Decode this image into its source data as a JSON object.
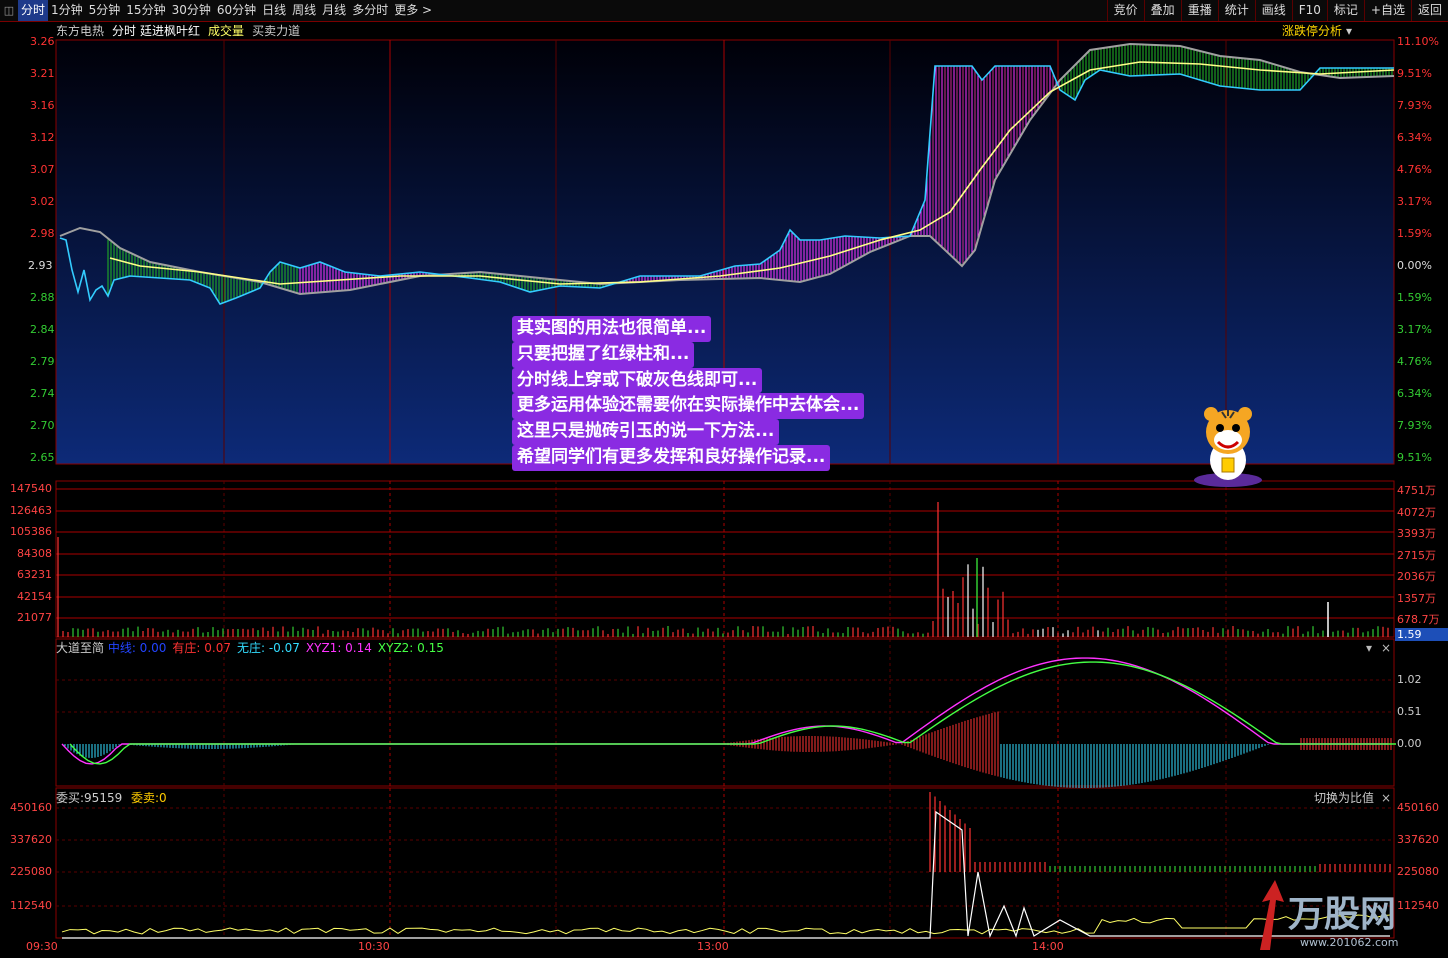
{
  "topbar": {
    "tabs": [
      "分时",
      "1分钟",
      "5分钟",
      "15分钟",
      "30分钟",
      "60分钟",
      "日线",
      "周线",
      "月线",
      "多分时",
      "更多 >"
    ],
    "active_tab": "分时",
    "right_buttons": [
      "竞价",
      "叠加",
      "重播",
      "统计",
      "画线",
      "F10",
      "标记",
      "+自选",
      "返回"
    ]
  },
  "info": {
    "stock": "东方电热",
    "period": "分时",
    "indicator": "廷进枫叶红",
    "volume_label": "成交量",
    "force_label": "买卖力道",
    "right_label": "涨跌停分析"
  },
  "price_axis": {
    "left": [
      "3.26",
      "3.21",
      "3.16",
      "3.12",
      "3.07",
      "3.02",
      "2.98",
      "2.93",
      "2.88",
      "2.84",
      "2.79",
      "2.74",
      "2.70",
      "2.65"
    ],
    "right": [
      "11.10%",
      "9.51%",
      "7.93%",
      "6.34%",
      "4.76%",
      "3.17%",
      "1.59%",
      "0.00%",
      "1.59%",
      "3.17%",
      "4.76%",
      "6.34%",
      "7.93%",
      "9.51%"
    ]
  },
  "volume_axis": {
    "left": [
      "147540",
      "126463",
      "105386",
      "84308",
      "63231",
      "42154",
      "21077"
    ],
    "right": [
      "4751万",
      "4072万",
      "3393万",
      "2715万",
      "2036万",
      "1357万",
      "678.7万"
    ],
    "badge": "1.59"
  },
  "annotation": [
    "其实图的用法也很简单...",
    "只要把握了红绿柱和...",
    "分时线上穿或下破灰色线即可...",
    "更多运用体验还需要你在实际操作中去体会...",
    "这里只是抛砖引玉的说一下方法...",
    "希望同学们有更多发挥和良好操作记录..."
  ],
  "indicator2": {
    "name": "大道至简",
    "items": [
      {
        "label": "中线",
        "value": "0.00",
        "color": "#2244ff"
      },
      {
        "label": "有庄",
        "value": "0.07",
        "color": "#ff3333"
      },
      {
        "label": "无庄",
        "value": "-0.07",
        "color": "#33ddff"
      },
      {
        "label": "XYZ1",
        "value": "0.14",
        "color": "#ff33ff"
      },
      {
        "label": "XYZ2",
        "value": "0.15",
        "color": "#44ff44"
      }
    ],
    "axis": [
      "1.02",
      "0.51",
      "0.00"
    ]
  },
  "indicator3": {
    "buy_label": "委买:95159",
    "sell_label": "委卖:0",
    "switch_label": "切换为比值",
    "axis_left": [
      "450160",
      "337620",
      "225080",
      "112540"
    ],
    "axis_right": [
      "450160",
      "337620",
      "225080",
      "112540"
    ]
  },
  "time_axis": [
    "09:30",
    "10:30",
    "13:00",
    "14:00"
  ],
  "colors": {
    "up": "#ff3333",
    "down": "#33cc33",
    "price_line": "#33ccff",
    "avg_line": "#ffff88",
    "accent": "#8a2be2",
    "magenta": "#ff33ff",
    "teal": "#33ddff"
  },
  "watermark": {
    "brand": "万股网",
    "url": "www.201062.com"
  },
  "icons": [
    "chart-toggle-icon",
    "chevron-down-icon",
    "close-icon",
    "tiger-mascot-icon"
  ]
}
